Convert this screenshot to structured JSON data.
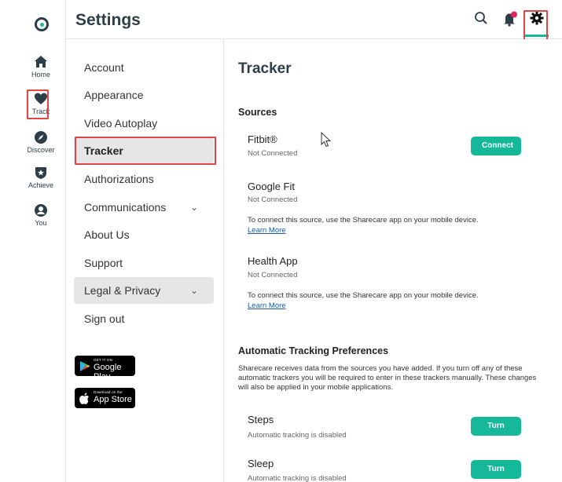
{
  "header": {
    "title": "Settings"
  },
  "rail": {
    "items": [
      {
        "label": "Home",
        "icon": "home-icon"
      },
      {
        "label": "Track",
        "icon": "heart-icon"
      },
      {
        "label": "Discover",
        "icon": "compass-icon"
      },
      {
        "label": "Achieve",
        "icon": "badge-star-icon"
      },
      {
        "label": "You",
        "icon": "user-icon"
      }
    ]
  },
  "menu": {
    "items": [
      {
        "label": "Account"
      },
      {
        "label": "Appearance"
      },
      {
        "label": "Video Autoplay"
      },
      {
        "label": "Tracker"
      },
      {
        "label": "Authorizations"
      },
      {
        "label": "Communications"
      },
      {
        "label": "About Us"
      },
      {
        "label": "Support"
      },
      {
        "label": "Legal & Privacy"
      },
      {
        "label": "Sign out"
      }
    ],
    "stores": {
      "google_small": "GET IT ON",
      "google_big": "Google Play",
      "apple_small": "Download on the",
      "apple_big": "App Store"
    }
  },
  "main": {
    "title": "Tracker",
    "sources_heading": "Sources",
    "sources": [
      {
        "name": "Fitbit®",
        "status": "Not Connected",
        "button": "Connect"
      },
      {
        "name": "Google Fit",
        "status": "Not Connected",
        "note": "To connect this source, use the Sharecare app on your mobile device.",
        "link": "Learn More"
      },
      {
        "name": "Health App",
        "status": "Not Connected",
        "note": "To connect this source, use the Sharecare app on your mobile device.",
        "link": "Learn More"
      }
    ],
    "prefs_heading": "Automatic Tracking Preferences",
    "prefs_desc": "Sharecare receives data from the sources you have added. If you turn off any of these automatic trackers you will be required to enter in these trackers manually. These changes will also be applied in your mobile applications.",
    "prefs": [
      {
        "name": "Steps",
        "status": "Automatic tracking is disabled",
        "button": "Turn On"
      },
      {
        "name": "Sleep",
        "status": "Automatic tracking is disabled",
        "button": "Turn On"
      }
    ]
  },
  "colors": {
    "accent": "#16b89a",
    "highlight": "#e14646",
    "text": "#2c3e48",
    "notification": "#e0245e"
  }
}
